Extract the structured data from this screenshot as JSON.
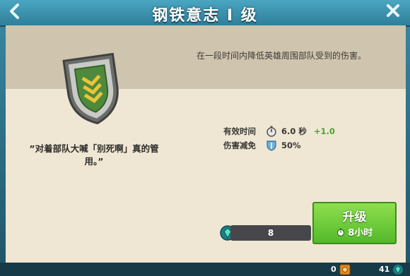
{
  "header": {
    "title": "钢铁意志 I 级",
    "back_icon": "chevron-left-icon",
    "close_icon": "close-icon"
  },
  "skill": {
    "description": "在一段时间内降低英雄周围部队受到的伤害。",
    "quote": "”对着部队大喊「别死啊」真的管用。”",
    "icon": "shield-chevron-icon"
  },
  "stats": [
    {
      "label": "有效时间",
      "icon": "stopwatch-icon",
      "value": "6.0 秒",
      "bonus": "+1.0"
    },
    {
      "label": "伤害减免",
      "icon": "shield-icon",
      "value": "50%",
      "bonus": ""
    }
  ],
  "cost": {
    "icon": "gem-icon",
    "value": "8"
  },
  "upgrade": {
    "label": "升级",
    "time": "8小时",
    "time_icon": "stopwatch-icon"
  },
  "footer": {
    "left_value": "0",
    "left_icon": "builder-icon",
    "right_value": "41",
    "right_icon": "gem-icon"
  },
  "colors": {
    "header": "#3a8fab",
    "panel": "#efe7d4",
    "strip": "#cfc4ae",
    "upgrade_button": "#6dcc3a",
    "bonus": "#4aa233"
  }
}
